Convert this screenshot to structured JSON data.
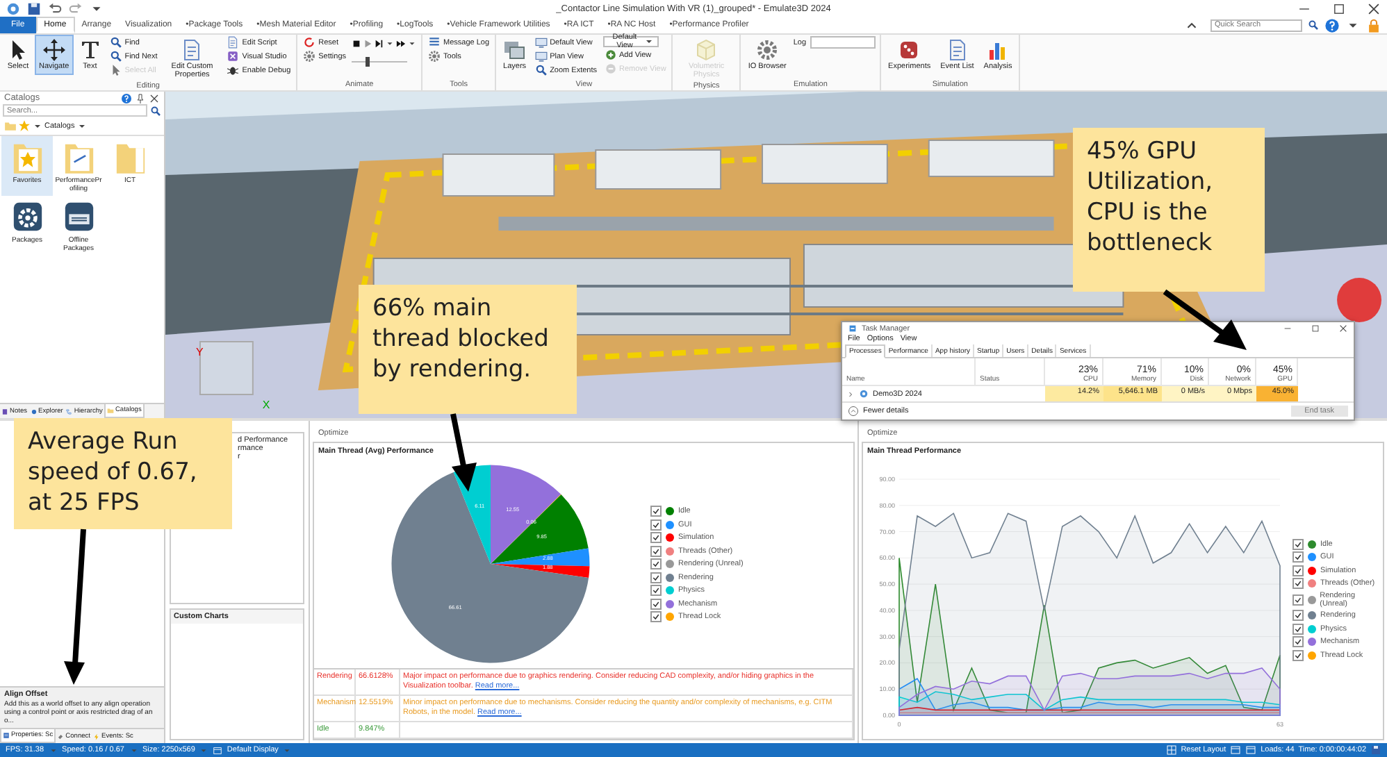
{
  "window": {
    "title": "_Contactor Line Simulation With VR (1)_grouped* - Emulate3D 2024"
  },
  "ribbon_tabs": [
    {
      "label": "File",
      "kind": "file",
      "selected": false
    },
    {
      "label": "Home",
      "kind": "tab",
      "selected": true
    },
    {
      "label": "Arrange",
      "kind": "tab",
      "selected": false
    },
    {
      "label": "Visualization",
      "kind": "tab",
      "selected": false
    },
    {
      "label": "•Package Tools",
      "kind": "tab",
      "selected": false
    },
    {
      "label": "•Mesh Material Editor",
      "kind": "tab",
      "selected": false
    },
    {
      "label": "•Profiling",
      "kind": "tab",
      "selected": false
    },
    {
      "label": "•LogTools",
      "kind": "tab",
      "selected": false
    },
    {
      "label": "•Vehicle Framework Utilities",
      "kind": "tab",
      "selected": false
    },
    {
      "label": "•RA ICT",
      "kind": "tab",
      "selected": false
    },
    {
      "label": "•RA NC Host",
      "kind": "tab",
      "selected": false
    },
    {
      "label": "•Performance Profiler",
      "kind": "tab",
      "selected": false
    }
  ],
  "quick_search": {
    "placeholder": "Quick Search"
  },
  "ribbon_groups": [
    {
      "label": "Editing",
      "columns": [
        [
          {
            "label": "Select",
            "kind": "large",
            "selected": false,
            "disabled": false
          }
        ],
        [
          {
            "label": "Navigate",
            "kind": "large",
            "selected": true,
            "disabled": false
          }
        ],
        [
          {
            "label": "Text",
            "kind": "large",
            "selected": false,
            "disabled": false
          }
        ],
        [
          {
            "label": "Find",
            "kind": "small",
            "disabled": false
          },
          {
            "label": "Find Next",
            "kind": "small",
            "disabled": false
          },
          {
            "label": "Select All",
            "kind": "small",
            "disabled": true
          }
        ],
        [
          {
            "label": "Edit Custom Properties",
            "kind": "large",
            "disabled": false
          }
        ],
        [
          {
            "label": "Edit Script",
            "kind": "small",
            "disabled": false
          },
          {
            "label": "Visual Studio",
            "kind": "small",
            "disabled": false
          },
          {
            "label": "Enable Debug",
            "kind": "small",
            "disabled": false
          }
        ]
      ]
    },
    {
      "label": "Animate",
      "columns": [
        [
          {
            "label": "Reset",
            "kind": "small",
            "disabled": false
          },
          {
            "label": "Settings",
            "kind": "small",
            "disabled": false
          }
        ],
        [
          {
            "kind": "playback"
          },
          {
            "kind": "slider",
            "level": 0.25
          }
        ]
      ]
    },
    {
      "label": "Tools",
      "columns": [
        [
          {
            "label": "Message Log",
            "kind": "small",
            "disabled": false
          },
          {
            "label": "Tools",
            "kind": "small",
            "disabled": false
          }
        ]
      ]
    },
    {
      "label": "View",
      "columns": [
        [
          {
            "label": "Layers",
            "kind": "large",
            "disabled": false
          }
        ],
        [
          {
            "label": "Default View",
            "kind": "small",
            "disabled": false
          },
          {
            "label": "Plan View",
            "kind": "small",
            "disabled": false
          },
          {
            "label": "Zoom Extents",
            "kind": "small",
            "disabled": false
          }
        ],
        [
          {
            "label": "Default View",
            "kind": "dropdown",
            "disabled": false
          },
          {
            "label": "Add View",
            "kind": "small",
            "disabled": false
          },
          {
            "label": "Remove View",
            "kind": "small",
            "disabled": true
          }
        ]
      ]
    },
    {
      "label": "Physics",
      "columns": [
        [
          {
            "label": "Volumetric Physics",
            "kind": "large",
            "disabled": true
          }
        ]
      ]
    },
    {
      "label": "Emulation",
      "columns": [
        [
          {
            "label": "IO Browser",
            "kind": "large",
            "disabled": false
          }
        ],
        [
          {
            "label": "Log",
            "kind": "field",
            "disabled": false
          }
        ]
      ]
    },
    {
      "label": "Simulation",
      "columns": [
        [
          {
            "label": "Experiments",
            "kind": "large",
            "disabled": false
          }
        ],
        [
          {
            "label": "Event List",
            "kind": "large",
            "disabled": false
          }
        ],
        [
          {
            "label": "Analysis",
            "kind": "large",
            "disabled": false
          }
        ]
      ]
    }
  ],
  "catalogs": {
    "title": "Catalogs",
    "search": {
      "placeholder": "Search..."
    },
    "breadcrumb": "Catalogs",
    "items": [
      {
        "label": "Favorites",
        "selected": true
      },
      {
        "label": "PerformanceProfiling",
        "selected": false
      },
      {
        "label": "ICT",
        "selected": false
      },
      {
        "label": "Packages",
        "selected": false
      },
      {
        "label": "Offline Packages",
        "selected": false
      }
    ],
    "tabs": [
      {
        "label": "Notes",
        "selected": false
      },
      {
        "label": "Explorer",
        "selected": false
      },
      {
        "label": "Hierarchy",
        "selected": false
      },
      {
        "label": "Catalogs",
        "selected": true
      }
    ]
  },
  "viewport": {
    "axis_labels": [
      "Y",
      "X"
    ]
  },
  "properties_panel": {
    "title": "Align Offset",
    "description": "Add this as a world offset to any align operation using a control point or axis restricted drag of an o...",
    "tabs": [
      {
        "label": "Properties: Sc",
        "selected": true
      },
      {
        "label": "Connect",
        "selected": false
      },
      {
        "label": "Events: Sc",
        "selected": false
      }
    ]
  },
  "custom_panel": {
    "items": [
      "d Performance",
      "rmance",
      "r"
    ],
    "custom_charts_title": "Custom Charts"
  },
  "pie_panel": {
    "tab_label": "Optimize",
    "title": "Main Thread (Avg) Performance",
    "chart_data": {
      "type": "pie",
      "categories": [
        "Idle",
        "GUI",
        "Simulation",
        "Threads (Other)",
        "Rendering (Unreal)",
        "Rendering",
        "Physics",
        "Mechanism",
        "Thread Lock"
      ],
      "values": [
        9.85,
        2.88,
        1.88,
        0.0,
        0.0,
        66.61,
        6.11,
        12.55,
        0.06
      ],
      "data_labels": true
    },
    "legend": [
      {
        "color": "#008000",
        "checked": true
      },
      {
        "color": "#1e90ff",
        "checked": true
      },
      {
        "color": "#ff0000",
        "checked": true
      },
      {
        "color": "#f08080",
        "checked": true
      },
      {
        "color": "#999999",
        "checked": true
      },
      {
        "color": "#708090",
        "checked": true
      },
      {
        "color": "#00ced1",
        "checked": true
      },
      {
        "color": "#9370db",
        "checked": true
      },
      {
        "color": "#ffa500",
        "checked": true
      }
    ],
    "findings": [
      {
        "category": "Rendering",
        "percent": "66.6128%",
        "message": "Major impact on performance due to graphics rendering. Consider reducing CAD complexity, and/or hiding graphics in the Visualization toolbar.",
        "link": "Read more...",
        "color": "#e8302a"
      },
      {
        "category": "Mechanism",
        "percent": "12.5519%",
        "message": "Minor impact on performance due to mechanisms. Consider reducing the quantity and/or complexity of mechanisms, e.g. CITM Robots, in the model.",
        "link": "Read more...",
        "color": "#e89a20"
      },
      {
        "category": "Idle",
        "percent": "9.847%",
        "color": "#3a9a3a"
      }
    ]
  },
  "line_panel": {
    "tab_label": "Optimize",
    "title": "Main Thread Performance",
    "chart_data": {
      "type": "area",
      "grid": true,
      "x": [
        0,
        3,
        6,
        9,
        12,
        15,
        18,
        21,
        24,
        27,
        30,
        33,
        36,
        39,
        42,
        45,
        48,
        51,
        54,
        57,
        60,
        63
      ],
      "xlim": [
        0,
        63
      ],
      "xticks": [
        0,
        63
      ],
      "ylim": [
        0,
        90
      ],
      "yticks": [
        {
          "value": 0,
          "label": "0.00"
        },
        {
          "value": 10,
          "label": "10.00"
        },
        {
          "value": 20,
          "label": "20.00"
        },
        {
          "value": 30,
          "label": "30.00"
        },
        {
          "value": 40,
          "label": "40.00"
        },
        {
          "value": 50,
          "label": "50.00"
        },
        {
          "value": 60,
          "label": "60.00"
        },
        {
          "value": 70,
          "label": "70.00"
        },
        {
          "value": 80,
          "label": "80.00"
        },
        {
          "value": 90,
          "label": "90.00"
        }
      ],
      "series": [
        {
          "name": "Idle",
          "color": "#2e8b2e",
          "values": [
            60,
            5,
            50,
            2,
            18,
            2,
            1,
            1,
            42,
            1,
            2,
            18,
            20,
            21,
            18,
            20,
            22,
            16,
            19,
            3,
            2,
            23
          ]
        },
        {
          "name": "GUI",
          "color": "#1e90ff",
          "values": [
            10,
            14,
            2,
            4,
            5,
            3,
            3,
            2,
            2,
            3,
            3,
            5,
            4,
            4,
            3,
            4,
            4,
            4,
            4,
            4,
            3,
            3
          ]
        },
        {
          "name": "Simulation",
          "color": "#ff0000",
          "values": [
            2,
            3,
            2,
            2,
            2,
            2,
            2,
            2,
            2,
            2,
            2,
            2,
            2,
            2,
            2,
            2,
            2,
            2,
            2,
            2,
            2,
            2
          ]
        },
        {
          "name": "Threads (Other)",
          "color": "#f08080",
          "values": [
            1,
            1,
            1,
            1,
            1,
            1,
            1,
            1,
            1,
            1,
            1,
            1,
            1,
            1,
            1,
            1,
            1,
            1,
            1,
            1,
            1,
            1
          ]
        },
        {
          "name": "Rendering",
          "color": "#708090",
          "values": [
            25,
            76,
            72,
            77,
            60,
            62,
            77,
            74,
            40,
            72,
            76,
            70,
            60,
            76,
            58,
            62,
            73,
            62,
            72,
            62,
            74,
            57
          ]
        },
        {
          "name": "Physics",
          "color": "#00ced1",
          "values": [
            7,
            5,
            9,
            8,
            6,
            7,
            8,
            8,
            2,
            6,
            7,
            6,
            6,
            6,
            6,
            6,
            6,
            6,
            6,
            5,
            5,
            4
          ]
        },
        {
          "name": "Mechanism",
          "color": "#9370db",
          "values": [
            3,
            8,
            11,
            10,
            13,
            12,
            15,
            15,
            2,
            15,
            16,
            14,
            14,
            15,
            15,
            15,
            16,
            14,
            16,
            16,
            18,
            10
          ]
        }
      ]
    },
    "legend": [
      {
        "checked": true
      },
      {
        "checked": true
      },
      {
        "checked": true
      },
      {
        "checked": true
      },
      {
        "label": "Rendering (Unreal)",
        "color": "#999999",
        "checked": true
      },
      {
        "checked": true
      },
      {
        "checked": true
      },
      {
        "checked": true
      },
      {
        "label": "Thread Lock",
        "color": "#ffa500",
        "checked": true
      }
    ]
  },
  "task_manager": {
    "title": "Task Manager",
    "menu": [
      "File",
      "Options",
      "View"
    ],
    "tabs": [
      {
        "label": "Processes",
        "selected": true
      },
      {
        "label": "Performance",
        "selected": false
      },
      {
        "label": "App history",
        "selected": false
      },
      {
        "label": "Startup",
        "selected": false
      },
      {
        "label": "Users",
        "selected": false
      },
      {
        "label": "Details",
        "selected": false
      },
      {
        "label": "Services",
        "selected": false
      }
    ],
    "columns": [
      {
        "label": "Name"
      },
      {
        "label": "Status"
      },
      {
        "percent": "23%",
        "label": "CPU"
      },
      {
        "percent": "71%",
        "label": "Memory"
      },
      {
        "percent": "10%",
        "label": "Disk"
      },
      {
        "percent": "0%",
        "label": "Network"
      },
      {
        "percent": "45%",
        "label": "GPU"
      }
    ],
    "rows": [
      {
        "cells": [
          {
            "text": "Demo3D 2024",
            "kind": "name"
          },
          {
            "text": ""
          },
          {
            "text": "14.2%",
            "color": "#fdeaa0"
          },
          {
            "text": "5,646.1 MB",
            "color": "#fde38a"
          },
          {
            "text": "0 MB/s",
            "color": "#fff4c4"
          },
          {
            "text": "0 Mbps",
            "color": "#fff4c4"
          },
          {
            "text": "45.0%",
            "color": "#f9b233"
          }
        ]
      }
    ],
    "fewer_details": "Fewer details",
    "end_task": {
      "label": "End task",
      "disabled": true
    }
  },
  "status_bar": {
    "left": [
      "FPS: 31.38",
      "Speed: 0.16 / 0.67",
      "Size: 2250x569",
      "Default Display"
    ],
    "reset_layout": "Reset Layout",
    "loads": "Loads: 44",
    "time": "Time: 0:00:00:44:02"
  },
  "callouts": [
    {
      "text": "Average Run speed of 0.67, at 25 FPS"
    },
    {
      "text": "66% main thread blocked by rendering."
    },
    {
      "text": "45% GPU Utilization, CPU is the bottleneck"
    }
  ]
}
